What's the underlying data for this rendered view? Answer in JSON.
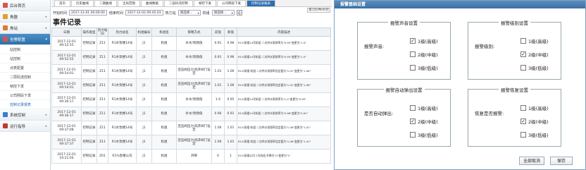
{
  "sidebar": {
    "items": [
      {
        "label": "后台首页",
        "icon": "home-icon",
        "color": "#d9534f"
      },
      {
        "label": "角器",
        "icon": "device-icon",
        "color": "#e0a030"
      },
      {
        "label": "角站",
        "icon": "station-icon",
        "color": "#e07a30"
      },
      {
        "label": "告警配置",
        "icon": "alarm-icon",
        "color": "#d9534f",
        "active": true
      }
    ],
    "subs": [
      "站控制",
      "站控制",
      "点表配置",
      "二层码流控制",
      "帧控下发",
      "公司网段下发",
      "控制记录报表"
    ],
    "bottom": [
      {
        "label": "系统控制",
        "icon": "system-icon",
        "color": "#3a7bd5"
      },
      {
        "label": "运行指导",
        "icon": "guide-icon",
        "color": "#c0392b"
      }
    ]
  },
  "tabs": [
    "首页",
    "历史曲线",
    "二期曲线",
    "全局范围",
    "曲线数据",
    "二层码流控制",
    "帧控下发",
    "公司网段下发",
    "控制记录报表"
  ],
  "filter": {
    "start_label": "开始时间",
    "start_value": "2017-12-01 00:00:00",
    "end_label": "结束时间",
    "end_value": "2017-12-02 09:45:03",
    "device_label": "热力站",
    "device_value": "请选择...",
    "unit_label": "机组",
    "unit_value": "请选择...",
    "query": "Q"
  },
  "page_title": "事件记录",
  "pager": {
    "text": "第1页/共(9)页"
  },
  "table": {
    "headers": [
      "日期",
      "操作类型",
      "热力站ID",
      "热力站名",
      "机组编号",
      "机组名",
      "策略方式",
      "前值",
      "新值",
      "内容描述"
    ],
    "rows": [
      [
        "2017-12-01 09:52:55",
        "控制记录",
        "Z11",
        "R1水泵楼14号",
        "J1",
        "机组",
        "补水/泵频值",
        "0.91",
        "0.96",
        "R1%泵楼14号机组·二次供水泵频率为\"0.95\"变更为\"1.0\""
      ],
      [
        "2017-12-01 09:52:55",
        "控制记录",
        "Z11",
        "R1水泵楼14号",
        "J1",
        "机组",
        "补水/泵频值",
        "0.91",
        "0.96",
        "R1%泵楼14号机组·二次供水泵频率为\"0.95\"变更为\"1.0\""
      ],
      [
        "2017-12-01 09:54:01",
        "控制记录",
        "Z11",
        "R1水泵楼14号",
        "J1",
        "机组",
        "连压阀压力/高开阀门设定",
        "1.01",
        "1.06",
        "R1%泵楼·机组·二次供水泵频率设定值为\"1.01\"变更为\"1.06\""
      ],
      [
        "2017-12-01 09:54:01",
        "控制记录",
        "Z11",
        "R1水泵楼14号",
        "J1",
        "机组",
        "连压阀压力/高开阀门设定",
        "1.01",
        "1.06",
        "R1%泵楼·机组·二次供水泵频率设定值为\"1.01\"变更为\"1.06\""
      ],
      [
        "2017-12-01 09:36:17",
        "控制记录",
        "Z11",
        "R1水泵楼14号",
        "J1",
        "机组",
        "补水/泵频值",
        "1.0",
        "0.95",
        "R1%泵楼14号机组·二次供水泵频率为\"1.0\"变更为\"0.95\""
      ],
      [
        "2017-12-01 09:36:17",
        "控制记录",
        "Z11",
        "R1水泵楼14号",
        "J1",
        "机组",
        "补水/泵频值",
        "0.96",
        "0.91",
        "R1%泵楼14号机组·二次供水泵频率为\"0.96\"变更为\"0.91\""
      ],
      [
        "2017-12-01 09:37:08",
        "控制记录",
        "Z11",
        "R1水泵楼14号",
        "J1",
        "机组",
        "连压阀压力/高开阀门设定",
        "1.06",
        "1.01",
        "R1%泵楼·机组·二次供水泵频率设定值为\"1.06\"变更为\"1.01\""
      ],
      [
        "2017-12-01 09:37:37",
        "控制记录",
        "Z11",
        "R1水泵楼14号",
        "J1",
        "机组",
        "连压阀压力/高开阀门设定",
        "1.06",
        "1.01",
        "R1%泵楼·机组·二次供水泵频率设定值为\"1.06\"变更为\"1.01\""
      ],
      [
        "2017-12-01 16:21:04",
        "控制记录",
        "Z01",
        "R1%泵楼公司",
        "J1",
        "机组",
        "开降",
        "0",
        "1",
        "R1%泵楼公司·1号机组·开降为\"0\"变更为\"1\""
      ]
    ]
  },
  "dialog": {
    "title": "报警基础设置",
    "groups": [
      {
        "title": "报警声音设置",
        "label": "报警声音:",
        "options": [
          {
            "label": "1级(高级)",
            "checked": true
          },
          {
            "label": "2级(中级)",
            "checked": false
          },
          {
            "label": "3级(低级)",
            "checked": false
          }
        ]
      },
      {
        "title": "报警级别设置",
        "label": "报警级别:",
        "options": [
          {
            "label": "1级(高级)",
            "checked": false
          },
          {
            "label": "2级(中级)",
            "checked": true
          },
          {
            "label": "3级(低级)",
            "checked": false
          }
        ]
      },
      {
        "title": "报警自动弹出设置",
        "label": "是否自动弹出:",
        "options": [
          {
            "label": "1级(高级)",
            "checked": false
          },
          {
            "label": "2级(中级)",
            "checked": true
          },
          {
            "label": "3级(低级)",
            "checked": false
          }
        ]
      },
      {
        "title": "报警恢复设置",
        "label": "恢复是否报警:",
        "options": [
          {
            "label": "1级(高级)",
            "checked": false
          },
          {
            "label": "2级(中级)",
            "checked": true
          },
          {
            "label": "3级(低级)",
            "checked": false
          }
        ]
      }
    ],
    "cancel": "全部取消",
    "save": "保存"
  }
}
